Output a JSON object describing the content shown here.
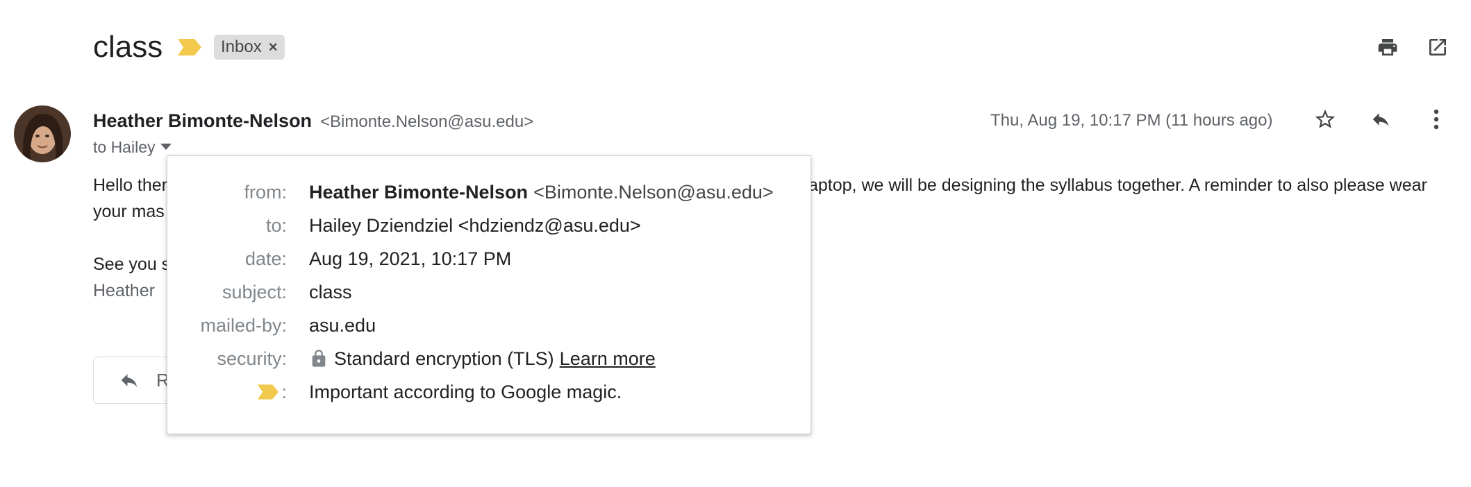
{
  "header": {
    "subject": "class",
    "label": "Inbox",
    "label_remove": "×",
    "icons": [
      "important-marker-icon",
      "print-icon",
      "open-in-new-window-icon"
    ],
    "accent_color": "#f2c94c"
  },
  "message": {
    "sender_name": "Heather Bimonte-Nelson",
    "sender_email": "<Bimonte.Nelson@asu.edu>",
    "to_line": "to Hailey",
    "date": "Thu, Aug 19, 10:17 PM (11 hours ago)",
    "body_line1_start": "Hello ther",
    "body_line1_end": "aptop, we will be designing the syllabus together. A reminder to also please wear",
    "body_line2": "your mas",
    "body_line3": "See you s",
    "signature": "Heather",
    "reply_button": "R"
  },
  "details": {
    "from_label": "from:",
    "from_name": "Heather Bimonte-Nelson",
    "from_email": "<Bimonte.Nelson@asu.edu>",
    "to_label": "to:",
    "to_value": "Hailey Dziendziel <hdziendz@asu.edu>",
    "date_label": "date:",
    "date_value": "Aug 19, 2021, 10:17 PM",
    "subject_label": "subject:",
    "subject_value": "class",
    "mailedby_label": "mailed-by:",
    "mailedby_value": "asu.edu",
    "security_label": "security:",
    "security_value": "Standard encryption (TLS)",
    "learn_more": "Learn more",
    "importance_colon": ":",
    "importance_value": "Important according to Google magic."
  }
}
